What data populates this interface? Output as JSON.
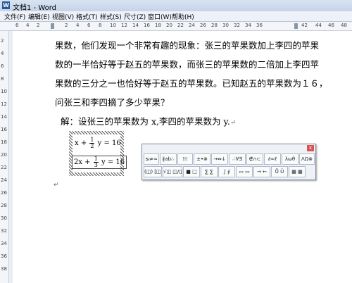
{
  "window": {
    "title": "文档1 - Word",
    "app_icon": "word-icon"
  },
  "menu": [
    "文件(F)",
    "编辑(E)",
    "视图(V)",
    "格式(T)",
    "样式(S)",
    "尺寸(Z)",
    "窗口(W)",
    "帮助(H)"
  ],
  "ruler": {
    "ticks": [
      "6",
      "4",
      "2",
      "",
      "2",
      "4",
      "6",
      "8",
      "10",
      "12",
      "14",
      "16",
      "18",
      "20",
      "22",
      "24",
      "26",
      "28",
      "30",
      "32",
      "34",
      "36",
      "40",
      "42",
      "44",
      "46",
      "48"
    ]
  },
  "vruler": {
    "ticks": [
      "2",
      "4",
      "6",
      "8",
      "10",
      "12",
      "14",
      "16",
      "18",
      "20",
      "22",
      "24",
      "26",
      "28",
      "30",
      "32",
      "34",
      "36",
      "38"
    ]
  },
  "document": {
    "lines": [
      "果数，他们发现一个非常有趣的现象：张三的苹果数加上李四的苹果",
      "数的一半恰好等于赵五的苹果数，而张三的苹果数的二倍加上李四苹",
      "果数的三分之一也恰好等于赵五的苹果数。已知赵五的苹果数为１６，",
      "问张三和李四摘了多少苹果？"
    ],
    "solution": "解：设张三的苹果数为 x,李四的苹果数为 y.",
    "paragraph_mark": "↵"
  },
  "equations": {
    "eq1": {
      "left": "x +",
      "num": "1",
      "den": "2",
      "right": "y = 16"
    },
    "eq2": {
      "left": "2x +",
      "num": "1",
      "den": "3",
      "right": "y = 16"
    }
  },
  "equation_toolbar": {
    "close": "x",
    "row1": [
      "≤≠≈",
      "∦ab∴",
      "⁞⁞⁞",
      "±•⊗",
      "→⇔↓",
      "∴∀∃",
      "∉∩⊂",
      "∂∞ℓ",
      "λωθ",
      "ΛΩ⊗"
    ],
    "row2": [
      "(◫) [◫]",
      "√◫ ◫/◫",
      "■ □",
      "∑ ∑",
      "∫ ∮",
      "▭ ▭",
      "→ ←",
      "Ů Û",
      "▦ ▦"
    ]
  }
}
